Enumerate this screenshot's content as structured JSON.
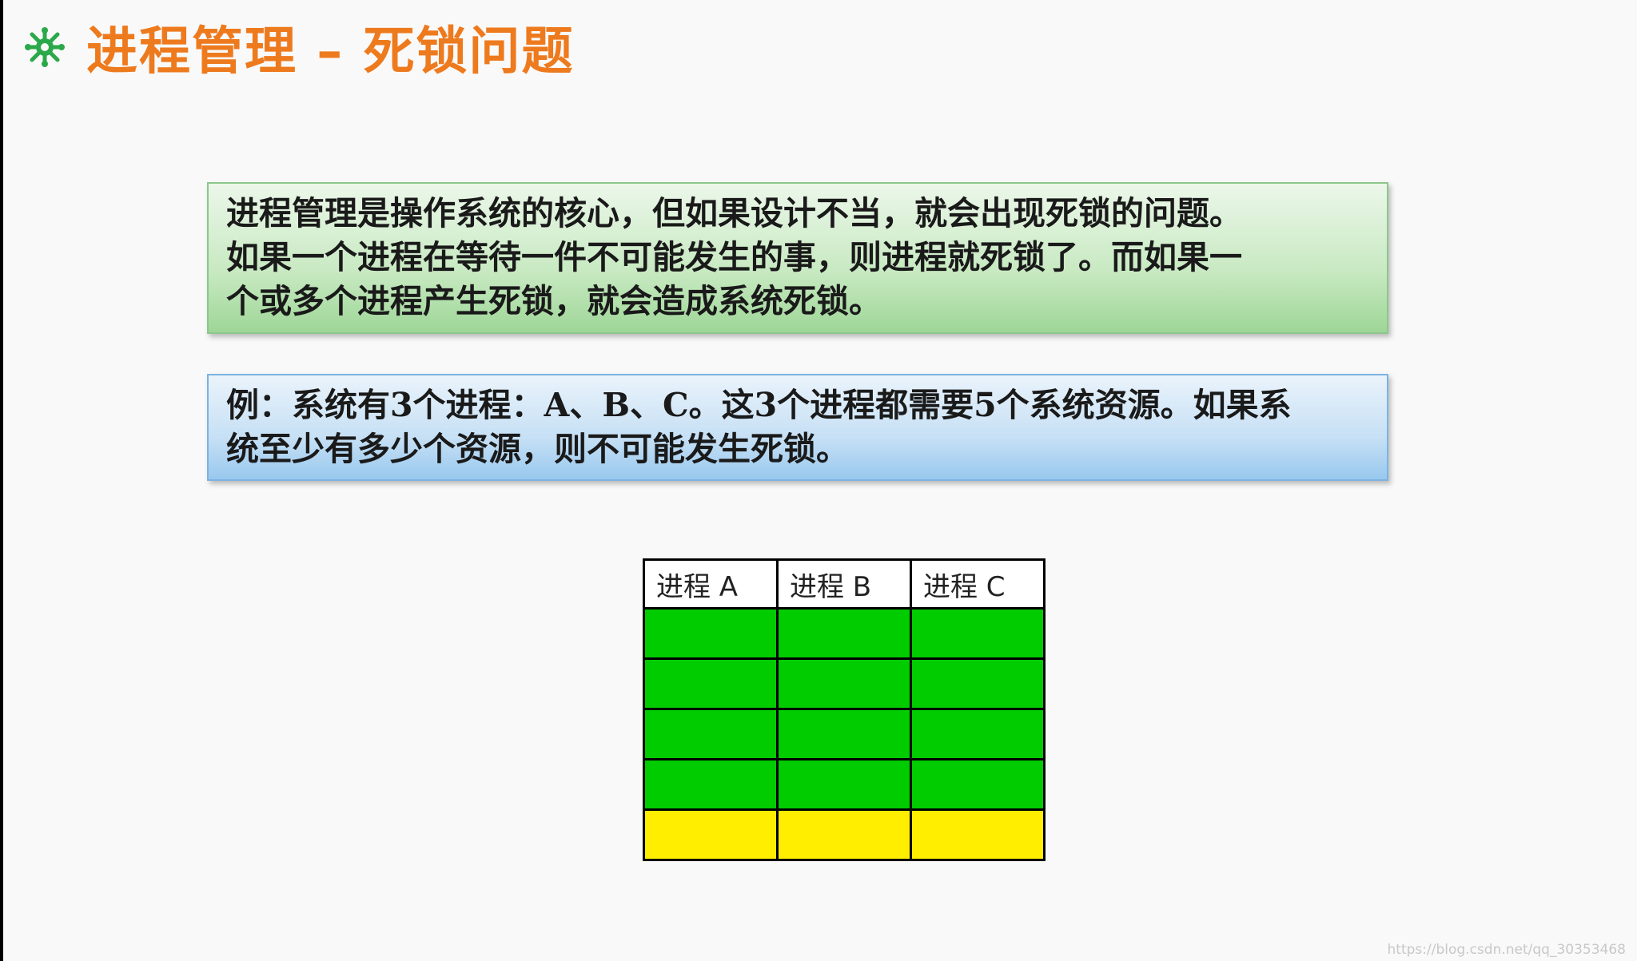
{
  "title": "进程管理 – 死锁问题",
  "title_icon": "snowflake-bullet-icon",
  "colors": {
    "title": "#ee7a1e",
    "icon": "#2aa84a",
    "held_resource": "#00cc00",
    "extra_resource": "#ffee00"
  },
  "intro": {
    "lines": [
      "进程管理是操作系统的核心，但如果设计不当，就会出现死锁的问题。",
      "如果一个进程在等待一件不可能发生的事，则进程就死锁了。而如果一",
      "个或多个进程产生死锁，就会造成系统死锁。"
    ]
  },
  "example": {
    "lines": [
      "例：系统有3个进程：A、B、C。这3个进程都需要5个系统资源。如果系",
      "统至少有多少个资源，则不可能发生死锁。"
    ]
  },
  "table": {
    "headers": [
      "进程 A",
      "进程 B",
      "进程 C"
    ],
    "resources_per_process": 5,
    "held_rows": 4,
    "extra_rows": 1
  },
  "watermark": "https://blog.csdn.net/qq_30353468"
}
